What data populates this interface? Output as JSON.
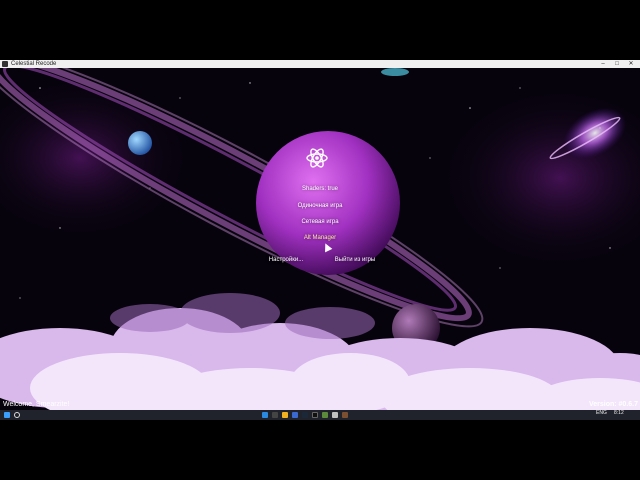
{
  "window": {
    "title": "Celestial Recode",
    "controls": {
      "minimize": "–",
      "maximize": "□",
      "close": "✕"
    }
  },
  "menu": {
    "shaders": "Shaders: true",
    "singleplayer": "Одиночная игра",
    "multiplayer": "Сетевая игра",
    "alt_manager": "Alt Manager",
    "settings": "Настройки...",
    "quit": "Выйти из игры"
  },
  "footer": {
    "welcome": "Welcome, Smearzite!",
    "version": "Version: #0.6.7"
  },
  "taskbar": {
    "language": "ENG",
    "time": "8:12"
  },
  "colors": {
    "accent": "#c05ae0",
    "planet": "#b43fd0",
    "sky": "#07030d",
    "taskbar": "#20232c"
  },
  "icons": [
    "windows-start-icon",
    "search-icon",
    "file-explorer-icon",
    "store-icon",
    "steam-icon",
    "terminal-icon",
    "minecraft-icon",
    "app-icon"
  ]
}
